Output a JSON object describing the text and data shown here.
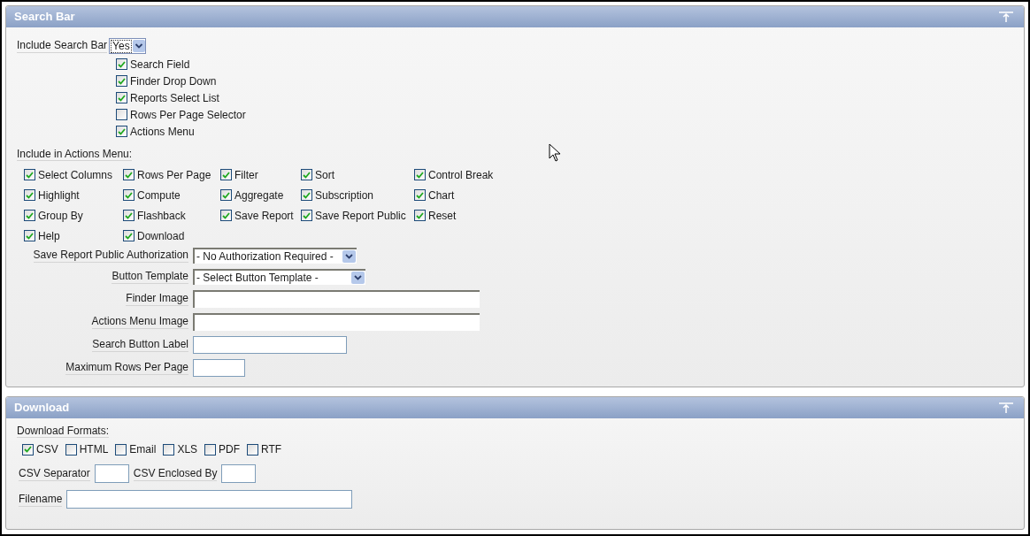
{
  "search_bar": {
    "title": "Search Bar",
    "include": {
      "label": "Include Search Bar",
      "value": "Yes"
    },
    "options": [
      {
        "label": "Search Field",
        "checked": true
      },
      {
        "label": "Finder Drop Down",
        "checked": true
      },
      {
        "label": "Reports Select List",
        "checked": true
      },
      {
        "label": "Rows Per Page Selector",
        "checked": false
      },
      {
        "label": "Actions Menu",
        "checked": true
      }
    ],
    "actions_menu": {
      "label": "Include in Actions Menu:",
      "items": [
        {
          "label": "Select Columns",
          "checked": true
        },
        {
          "label": "Rows Per Page",
          "checked": true
        },
        {
          "label": "Filter",
          "checked": true
        },
        {
          "label": "Sort",
          "checked": true
        },
        {
          "label": "Control Break",
          "checked": true
        },
        {
          "label": "Highlight",
          "checked": true
        },
        {
          "label": "Compute",
          "checked": true
        },
        {
          "label": "Aggregate",
          "checked": true
        },
        {
          "label": "Subscription",
          "checked": true
        },
        {
          "label": "Chart",
          "checked": true
        },
        {
          "label": "Group By",
          "checked": true
        },
        {
          "label": "Flashback",
          "checked": true
        },
        {
          "label": "Save Report",
          "checked": true
        },
        {
          "label": "Save Report Public",
          "checked": true
        },
        {
          "label": "Reset",
          "checked": true
        },
        {
          "label": "Help",
          "checked": true
        },
        {
          "label": "Download",
          "checked": true
        }
      ]
    },
    "fields": [
      {
        "kind": "select",
        "label": "Save Report Public Authorization",
        "value": "- No Authorization Required -"
      },
      {
        "kind": "select",
        "label": "Button Template",
        "value": "- Select Button Template -"
      },
      {
        "kind": "text",
        "label": "Finder Image"
      },
      {
        "kind": "text",
        "label": "Actions Menu Image"
      },
      {
        "kind": "text",
        "label": "Search Button Label"
      },
      {
        "kind": "text",
        "label": "Maximum Rows Per Page"
      }
    ]
  },
  "download": {
    "title": "Download",
    "formats_label": "Download Formats:",
    "formats": [
      {
        "label": "CSV",
        "checked": true
      },
      {
        "label": "HTML",
        "checked": false
      },
      {
        "label": "Email",
        "checked": false
      },
      {
        "label": "XLS",
        "checked": false
      },
      {
        "label": "PDF",
        "checked": false
      },
      {
        "label": "RTF",
        "checked": false
      }
    ],
    "csv_separator": {
      "label": "CSV Separator"
    },
    "csv_enclosed_by": {
      "label": "CSV Enclosed By"
    },
    "filename": {
      "label": "Filename"
    }
  }
}
